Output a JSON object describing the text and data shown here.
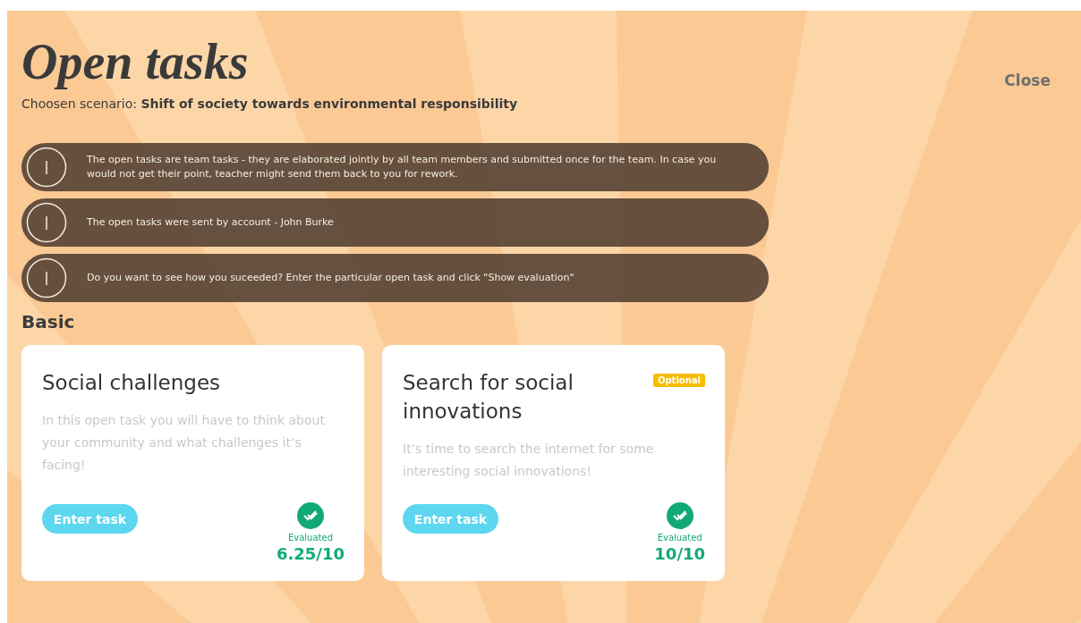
{
  "title": "Open tasks",
  "scenario": {
    "label": "Choosen scenario:",
    "value": "Shift of society towards environmental responsibility"
  },
  "close": "Close",
  "notices": [
    {
      "text": "The open tasks are team tasks - they are elaborated jointly by all team members and submitted once for the team. In case you would not get their point, teacher might send them back to you for rework."
    },
    {
      "text": "The open tasks were sent by account - John Burke"
    },
    {
      "text": "Do you want to see how you suceeded? Enter the particular open task and click \"Show evaluation\""
    }
  ],
  "section": "Basic",
  "tasks": [
    {
      "title": "Social challenges",
      "optional": false,
      "description": "In this open task you will have to think about your community and what challenges it’s facing!",
      "button": "Enter task",
      "evaluated": true,
      "status": "Evaluated",
      "score": "6.25/10"
    },
    {
      "title": "Search for social innovations",
      "optional": true,
      "badge": "Optional",
      "description": "It’s time to search the internet for some interesting social innovations!",
      "button": "Enter task",
      "evaluated": true,
      "status": "Evaluated",
      "score": "10/10"
    }
  ]
}
